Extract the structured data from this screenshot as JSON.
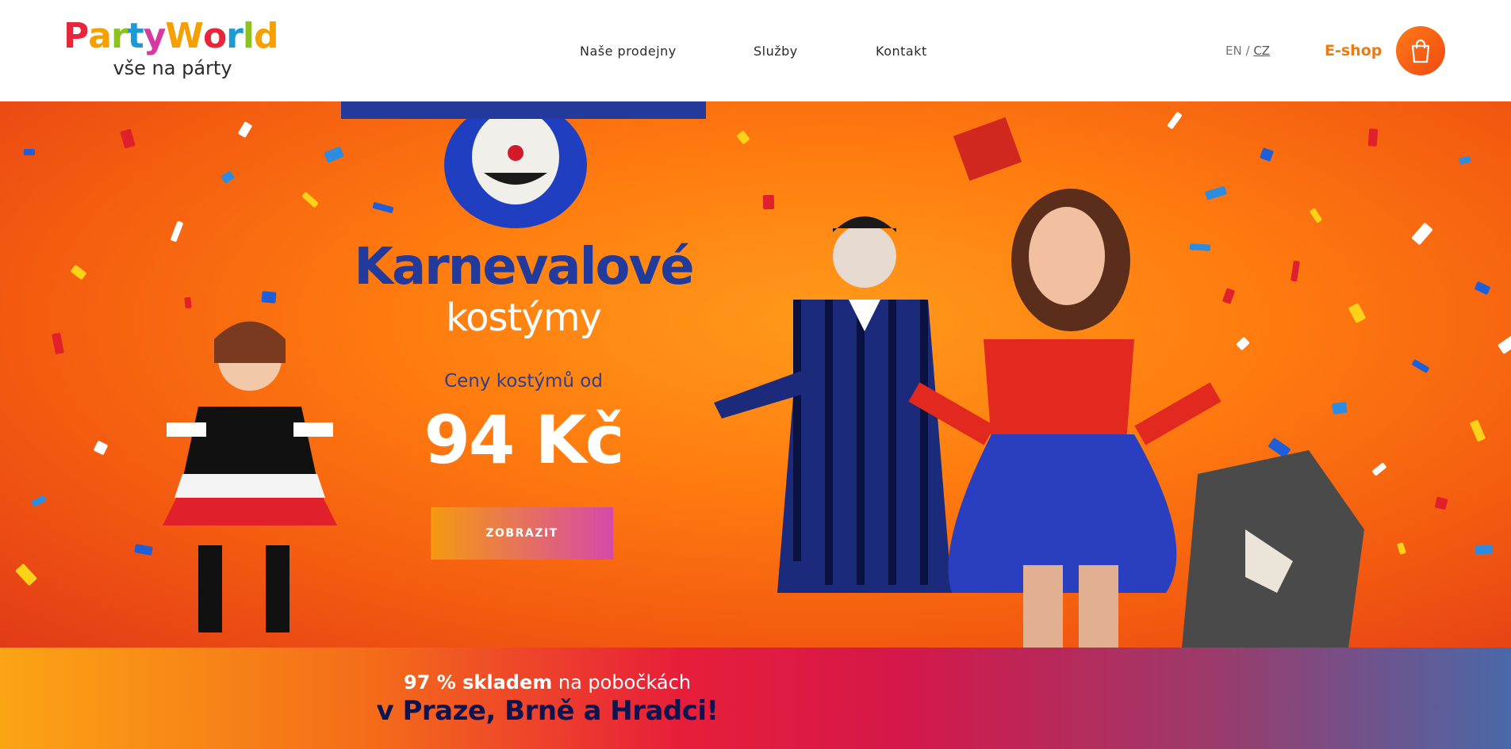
{
  "header": {
    "logo": {
      "word_parts": [
        "Party",
        "World"
      ],
      "tagline": "vše na párty"
    },
    "nav": [
      "Naše prodejny",
      "Služby",
      "Kontakt"
    ],
    "lang": {
      "en": "EN",
      "sep": "/",
      "cz": "CZ"
    },
    "eshop": "E-shop",
    "cart_icon": "shopping-bag-icon"
  },
  "hero": {
    "title": "Karnevalové",
    "subtitle": "kostýmy",
    "price_label": "Ceny kostýmů od",
    "price": "94 Kč",
    "button": "ZOBRAZIT"
  },
  "band": {
    "line1_bold": "97 % skladem",
    "line1_rest": " na pobočkách",
    "line2": "v Praze, Brně a Hradci!"
  },
  "colors": {
    "accent_orange": "#f07a10",
    "title_blue": "#213a9c",
    "band_text": "#0e1450"
  }
}
